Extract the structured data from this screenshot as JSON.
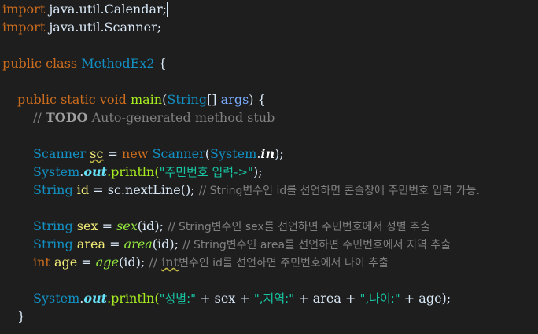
{
  "editor": {
    "lines": [
      {
        "id": "l1"
      },
      {
        "id": "l2"
      }
    ],
    "code": {
      "import1_kw": "import",
      "import1_pkg": " java.util.Calendar;",
      "import2_kw": "import",
      "import2_pkg": " java.util.Scanner;",
      "class_kw": "public class ",
      "class_name": "MethodEx2",
      "class_brace": " {",
      "main_kw": "public static void ",
      "main_name": "main",
      "main_open": "(",
      "main_type": "String",
      "main_arr": "[] ",
      "main_param": "args",
      "main_close": ") {",
      "todo_prefix": "// ",
      "todo_tag": "TODO",
      "todo_text": " Auto-generated method stub",
      "sc_type": "Scanner ",
      "sc_var": "sc",
      "sc_eq": " = ",
      "sc_new": "new ",
      "sc_cls": "Scanner",
      "sc_open": "(",
      "sc_system": "System",
      "sc_dot": ".",
      "sc_in": "in",
      "sc_close": ");",
      "p1_system": "System",
      "p1_dot": ".",
      "p1_out": "out",
      "p1_call": ".println(",
      "p1_str": "\"주민번호 입력->\"",
      "p1_close": ");",
      "id_type": "String ",
      "id_var": "id",
      "id_eq": " = sc.nextLine(); ",
      "id_comment": "// String변수인 id를 선언하면 콘솔창에 주민번호 입력 가능.",
      "sex_type": "String ",
      "sex_var": "sex",
      "sex_eq": " = ",
      "sex_fn": "sex",
      "sex_args": "(id); ",
      "sex_comment": "// String변수인 sex를 선언하면 주민번호에서 성별 추출",
      "area_type": "String ",
      "area_var": "area",
      "area_eq": " = ",
      "area_fn": "area",
      "area_args": "(id); ",
      "area_comment": "// String변수인 area를 선언하면 주민번호에서 지역 추출",
      "age_type": "int ",
      "age_var": "age",
      "age_eq": " = ",
      "age_fn": "age",
      "age_args": "(id); ",
      "age_comment_pre": "// ",
      "age_comment_int": "int",
      "age_comment": "변수인 id를 선언하면 주민번호에서 나이 추출",
      "p2_system": "System",
      "p2_dot": ".",
      "p2_out": "out",
      "p2_call": ".println(",
      "p2_str1": "\"성별:\"",
      "p2_plus1": " + sex + ",
      "p2_str2": "\",지역:\"",
      "p2_plus2": " + area + ",
      "p2_str3": "\",나이:\"",
      "p2_plus3": " + age);",
      "close_brace": "}"
    }
  },
  "colors": {
    "background": "#1e1e1e",
    "keyword": "#cc6c1d",
    "type": "#1290c3",
    "method": "#a7ec21",
    "string": "#17c6a3",
    "comment": "#808080",
    "variable": "#f3ec79"
  }
}
